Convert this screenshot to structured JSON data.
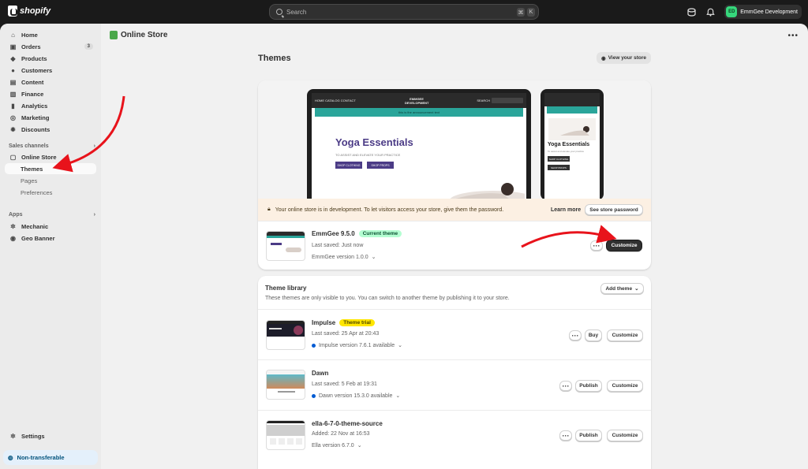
{
  "topbar": {
    "brand": "shopify",
    "search_placeholder": "Search",
    "shortcut_keys": [
      "⌘",
      "K"
    ],
    "store_initials": "ED",
    "store_name": "EmmGee Development"
  },
  "sidebar": {
    "items": [
      {
        "label": "Home",
        "icon": "home-icon"
      },
      {
        "label": "Orders",
        "icon": "orders-icon",
        "badge": "3"
      },
      {
        "label": "Products",
        "icon": "tag-icon"
      },
      {
        "label": "Customers",
        "icon": "person-icon"
      },
      {
        "label": "Content",
        "icon": "content-icon"
      },
      {
        "label": "Finance",
        "icon": "finance-icon"
      },
      {
        "label": "Analytics",
        "icon": "analytics-icon"
      },
      {
        "label": "Marketing",
        "icon": "marketing-icon"
      },
      {
        "label": "Discounts",
        "icon": "discount-icon"
      }
    ],
    "sales_channels_label": "Sales channels",
    "online_store": "Online Store",
    "sub_items": [
      "Themes",
      "Pages",
      "Preferences"
    ],
    "apps_label": "Apps",
    "apps": [
      "Mechanic",
      "Geo Banner"
    ],
    "settings": "Settings",
    "non_transferable": "Non-transferable"
  },
  "main": {
    "section_title": "Online Store",
    "page_title": "Themes",
    "view_store": "View your store",
    "preview": {
      "laptop_nav": [
        "HOME",
        "CATALOG",
        "CONTACT"
      ],
      "laptop_brand": "EMMGEE DEVELOPMENT",
      "laptop_search": "SEARCH",
      "laptop_currency": "USD",
      "laptop_announcement": "this is the announcement text",
      "headline": "Yoga Essentials",
      "subheadline": "TO ASSIST AND ELEVATE YOUR PRACTICE",
      "btn_shop_clothing": "SHOP CLOTHING",
      "btn_shop_props": "SHOP PROPS",
      "phone_menu": "MENU",
      "phone_brand": "EMMGEE DEVELOPMENT",
      "phone_sub": "To assist and elevate your practice",
      "phone_btn_1": "SHOP CLOTHING",
      "phone_btn_2": "SHOP PROPS"
    },
    "dev_notice": "Your online store is in development. To let visitors access your store, give them the password.",
    "learn_more": "Learn more",
    "see_password": "See store password",
    "current": {
      "name": "EmmGee 9.5.0",
      "badge": "Current theme",
      "saved": "Last saved: Just now",
      "version": "EmmGee version 1.0.0",
      "customize": "Customize"
    },
    "library": {
      "title": "Theme library",
      "description": "These themes are only visible to you. You can switch to another theme by publishing it to your store.",
      "add_theme": "Add theme",
      "themes": [
        {
          "name": "Impulse",
          "badge": "Theme trial",
          "saved": "Last saved: 25 Apr at 20:43",
          "version": "Impulse version 7.6.1 available",
          "action": "Buy",
          "customize": "Customize"
        },
        {
          "name": "Dawn",
          "saved": "Last saved: 5 Feb at 19:31",
          "version": "Dawn version 15.3.0 available",
          "action": "Publish",
          "customize": "Customize"
        },
        {
          "name": "ella-6-7-0-theme-source",
          "saved": "Added: 22 Nov at 16:53",
          "version": "Ella version 6.7.0",
          "action": "Publish",
          "customize": "Customize"
        }
      ]
    }
  },
  "colors": {
    "accent_arrow": "#e8131b",
    "topbar": "#1a1a1a",
    "theme_banner": "#2aa59a",
    "headline": "#4b3b86"
  }
}
